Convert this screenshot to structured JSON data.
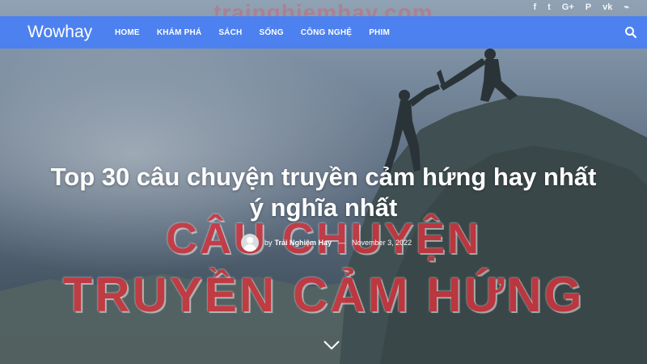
{
  "site": {
    "brand": "Wowhay"
  },
  "watermark": {
    "domain": "trainghiemhay.com"
  },
  "social_icons": [
    "facebook-icon",
    "twitter-icon",
    "google-plus-icon",
    "pinterest-icon",
    "vk-icon",
    "rss-icon"
  ],
  "social_glyphs": {
    "facebook": "f",
    "twitter": "t",
    "google_plus": "G+",
    "pinterest": "P",
    "vk": "vk",
    "rss": "⌁"
  },
  "nav": {
    "items": [
      "HOME",
      "KHÁM PHÁ",
      "SÁCH",
      "SỐNG",
      "CÔNG NGHỆ",
      "PHIM"
    ],
    "search_icon": "search-icon",
    "bar_color": "#487ff4"
  },
  "hero": {
    "banner_line_1": "CÂU CHUYỆN",
    "banner_line_2": "TRUYỀN CẢM HỨNG",
    "banner_color": "#d7343d"
  },
  "article": {
    "title": "Top 30 câu chuyện truyền cảm hứng hay nhất ý nghĩa nhất",
    "by": "by",
    "author": "Trải Nghiệm Hay",
    "separator": "—",
    "date": "November 3, 2022"
  },
  "scroll_icon": "chevron-down-icon"
}
